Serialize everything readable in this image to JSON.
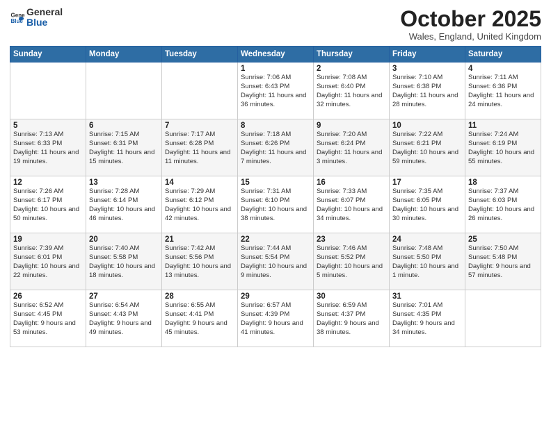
{
  "header": {
    "logo": {
      "general": "General",
      "blue": "Blue"
    },
    "title": "October 2025",
    "subtitle": "Wales, England, United Kingdom"
  },
  "weekdays": [
    "Sunday",
    "Monday",
    "Tuesday",
    "Wednesday",
    "Thursday",
    "Friday",
    "Saturday"
  ],
  "weeks": [
    [
      {
        "day": "",
        "sunrise": "",
        "sunset": "",
        "daylight": ""
      },
      {
        "day": "",
        "sunrise": "",
        "sunset": "",
        "daylight": ""
      },
      {
        "day": "",
        "sunrise": "",
        "sunset": "",
        "daylight": ""
      },
      {
        "day": "1",
        "sunrise": "Sunrise: 7:06 AM",
        "sunset": "Sunset: 6:43 PM",
        "daylight": "Daylight: 11 hours and 36 minutes."
      },
      {
        "day": "2",
        "sunrise": "Sunrise: 7:08 AM",
        "sunset": "Sunset: 6:40 PM",
        "daylight": "Daylight: 11 hours and 32 minutes."
      },
      {
        "day": "3",
        "sunrise": "Sunrise: 7:10 AM",
        "sunset": "Sunset: 6:38 PM",
        "daylight": "Daylight: 11 hours and 28 minutes."
      },
      {
        "day": "4",
        "sunrise": "Sunrise: 7:11 AM",
        "sunset": "Sunset: 6:36 PM",
        "daylight": "Daylight: 11 hours and 24 minutes."
      }
    ],
    [
      {
        "day": "5",
        "sunrise": "Sunrise: 7:13 AM",
        "sunset": "Sunset: 6:33 PM",
        "daylight": "Daylight: 11 hours and 19 minutes."
      },
      {
        "day": "6",
        "sunrise": "Sunrise: 7:15 AM",
        "sunset": "Sunset: 6:31 PM",
        "daylight": "Daylight: 11 hours and 15 minutes."
      },
      {
        "day": "7",
        "sunrise": "Sunrise: 7:17 AM",
        "sunset": "Sunset: 6:28 PM",
        "daylight": "Daylight: 11 hours and 11 minutes."
      },
      {
        "day": "8",
        "sunrise": "Sunrise: 7:18 AM",
        "sunset": "Sunset: 6:26 PM",
        "daylight": "Daylight: 11 hours and 7 minutes."
      },
      {
        "day": "9",
        "sunrise": "Sunrise: 7:20 AM",
        "sunset": "Sunset: 6:24 PM",
        "daylight": "Daylight: 11 hours and 3 minutes."
      },
      {
        "day": "10",
        "sunrise": "Sunrise: 7:22 AM",
        "sunset": "Sunset: 6:21 PM",
        "daylight": "Daylight: 10 hours and 59 minutes."
      },
      {
        "day": "11",
        "sunrise": "Sunrise: 7:24 AM",
        "sunset": "Sunset: 6:19 PM",
        "daylight": "Daylight: 10 hours and 55 minutes."
      }
    ],
    [
      {
        "day": "12",
        "sunrise": "Sunrise: 7:26 AM",
        "sunset": "Sunset: 6:17 PM",
        "daylight": "Daylight: 10 hours and 50 minutes."
      },
      {
        "day": "13",
        "sunrise": "Sunrise: 7:28 AM",
        "sunset": "Sunset: 6:14 PM",
        "daylight": "Daylight: 10 hours and 46 minutes."
      },
      {
        "day": "14",
        "sunrise": "Sunrise: 7:29 AM",
        "sunset": "Sunset: 6:12 PM",
        "daylight": "Daylight: 10 hours and 42 minutes."
      },
      {
        "day": "15",
        "sunrise": "Sunrise: 7:31 AM",
        "sunset": "Sunset: 6:10 PM",
        "daylight": "Daylight: 10 hours and 38 minutes."
      },
      {
        "day": "16",
        "sunrise": "Sunrise: 7:33 AM",
        "sunset": "Sunset: 6:07 PM",
        "daylight": "Daylight: 10 hours and 34 minutes."
      },
      {
        "day": "17",
        "sunrise": "Sunrise: 7:35 AM",
        "sunset": "Sunset: 6:05 PM",
        "daylight": "Daylight: 10 hours and 30 minutes."
      },
      {
        "day": "18",
        "sunrise": "Sunrise: 7:37 AM",
        "sunset": "Sunset: 6:03 PM",
        "daylight": "Daylight: 10 hours and 26 minutes."
      }
    ],
    [
      {
        "day": "19",
        "sunrise": "Sunrise: 7:39 AM",
        "sunset": "Sunset: 6:01 PM",
        "daylight": "Daylight: 10 hours and 22 minutes."
      },
      {
        "day": "20",
        "sunrise": "Sunrise: 7:40 AM",
        "sunset": "Sunset: 5:58 PM",
        "daylight": "Daylight: 10 hours and 18 minutes."
      },
      {
        "day": "21",
        "sunrise": "Sunrise: 7:42 AM",
        "sunset": "Sunset: 5:56 PM",
        "daylight": "Daylight: 10 hours and 13 minutes."
      },
      {
        "day": "22",
        "sunrise": "Sunrise: 7:44 AM",
        "sunset": "Sunset: 5:54 PM",
        "daylight": "Daylight: 10 hours and 9 minutes."
      },
      {
        "day": "23",
        "sunrise": "Sunrise: 7:46 AM",
        "sunset": "Sunset: 5:52 PM",
        "daylight": "Daylight: 10 hours and 5 minutes."
      },
      {
        "day": "24",
        "sunrise": "Sunrise: 7:48 AM",
        "sunset": "Sunset: 5:50 PM",
        "daylight": "Daylight: 10 hours and 1 minute."
      },
      {
        "day": "25",
        "sunrise": "Sunrise: 7:50 AM",
        "sunset": "Sunset: 5:48 PM",
        "daylight": "Daylight: 9 hours and 57 minutes."
      }
    ],
    [
      {
        "day": "26",
        "sunrise": "Sunrise: 6:52 AM",
        "sunset": "Sunset: 4:45 PM",
        "daylight": "Daylight: 9 hours and 53 minutes."
      },
      {
        "day": "27",
        "sunrise": "Sunrise: 6:54 AM",
        "sunset": "Sunset: 4:43 PM",
        "daylight": "Daylight: 9 hours and 49 minutes."
      },
      {
        "day": "28",
        "sunrise": "Sunrise: 6:55 AM",
        "sunset": "Sunset: 4:41 PM",
        "daylight": "Daylight: 9 hours and 45 minutes."
      },
      {
        "day": "29",
        "sunrise": "Sunrise: 6:57 AM",
        "sunset": "Sunset: 4:39 PM",
        "daylight": "Daylight: 9 hours and 41 minutes."
      },
      {
        "day": "30",
        "sunrise": "Sunrise: 6:59 AM",
        "sunset": "Sunset: 4:37 PM",
        "daylight": "Daylight: 9 hours and 38 minutes."
      },
      {
        "day": "31",
        "sunrise": "Sunrise: 7:01 AM",
        "sunset": "Sunset: 4:35 PM",
        "daylight": "Daylight: 9 hours and 34 minutes."
      },
      {
        "day": "",
        "sunrise": "",
        "sunset": "",
        "daylight": ""
      }
    ]
  ]
}
